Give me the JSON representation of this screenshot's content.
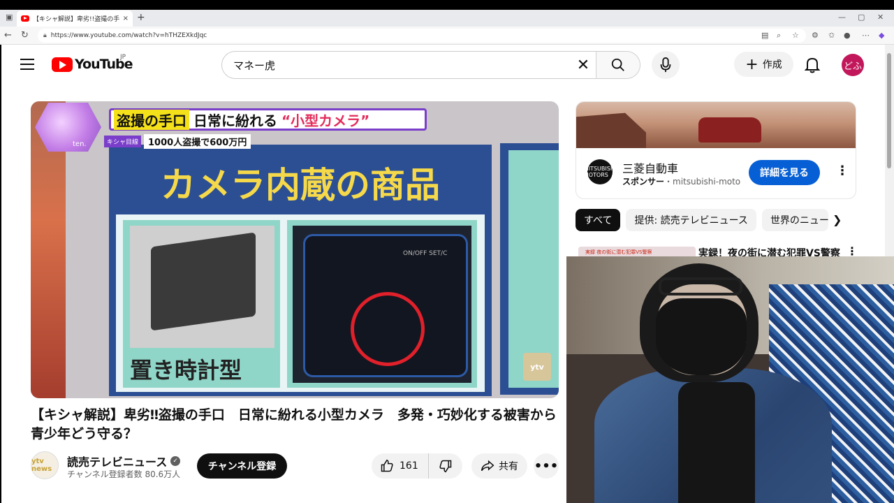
{
  "browser": {
    "tab_title": "【キシャ解説】卑劣!!盗撮の手口",
    "tab_close": "×",
    "new_tab": "+",
    "url": "https://www.youtube.com/watch?v=hTHZEXkdJqc",
    "window_controls": [
      "—",
      "▢",
      "✕"
    ]
  },
  "header": {
    "logo_text": "YouTube",
    "region": "JP",
    "search_value": "マネー虎",
    "create_label": "作成",
    "avatar_text": "どふ"
  },
  "video": {
    "banner_yellow": "盗撮の手口",
    "banner_black": "日常に紛れる",
    "banner_red": "“小型カメラ”",
    "tag": "キシャ目線",
    "subtext": "1000人盗撮で600万円",
    "headline": "カメラ内蔵の商品",
    "item_label": "置き時計型",
    "onoff": "ON/OFF SET/C",
    "logo_ten": "ten.",
    "ytv_mark": "ytv"
  },
  "title": "【キシャ解説】卑劣‼盗撮の手口　日常に紛れる小型カメラ　多発・巧妙化する被害から青少年どう守る？",
  "channel": {
    "avatar_text": "ytv news",
    "name": "読売テレビニュース",
    "subscribers": "チャンネル登録者数 80.6万人",
    "subscribe_label": "チャンネル登録"
  },
  "actions": {
    "like_count": "161",
    "share_label": "共有",
    "more_label": "•••"
  },
  "ad": {
    "advertiser": "三菱自動車",
    "sponsor_label": "スポンサー",
    "sponsor_domain": "・mitsubishi-moto...",
    "button_label": "詳細を見る",
    "logo_text": "MITSUBISHI MOTORS"
  },
  "chips": [
    "すべて",
    "提供: 読売テレビニュース",
    "世界のニュース"
  ],
  "recommendation": {
    "thumb_text": "実録 夜の街に潜む犯罪VS警察",
    "title": "実録！夜の街に潜む犯罪VS警察"
  },
  "colors": {
    "brand_red": "#ff0000",
    "subscribe_bg": "#0f0f0f",
    "ad_button": "#065fd4"
  }
}
